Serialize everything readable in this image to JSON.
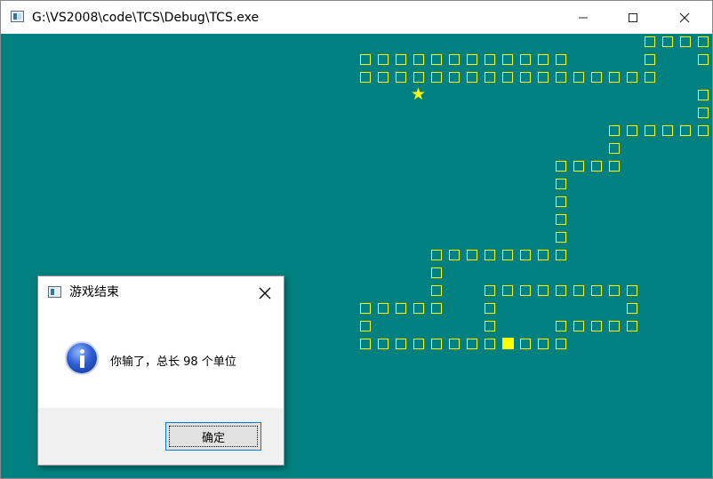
{
  "window": {
    "title": "G:\\VS2008\\code\\TCS\\Debug\\TCS.exe",
    "app_icon": "console-app-icon",
    "controls": [
      "minimize-icon",
      "maximize-icon",
      "close-icon"
    ]
  },
  "game": {
    "background_color": "#008080",
    "snake_color": "#ffff00",
    "food_symbol": "★",
    "head_symbol": "■",
    "body_symbol": "□"
  },
  "dialog": {
    "title": "游戏结束",
    "message": "你输了，总长 98 个单位",
    "icon": "information-icon",
    "ok_label": "确定"
  }
}
